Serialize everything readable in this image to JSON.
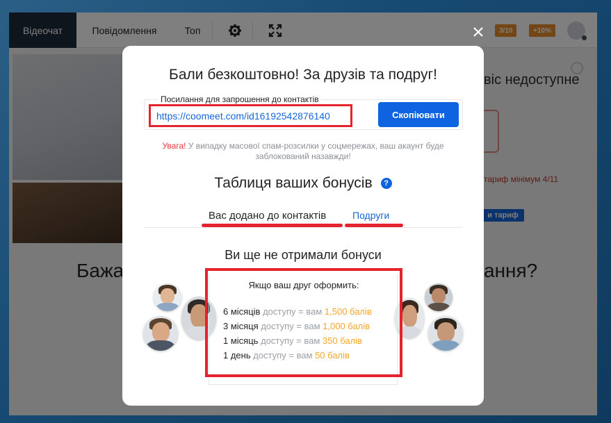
{
  "topbar": {
    "tabs": [
      "Відеочат",
      "Повідомлення",
      "Топ"
    ],
    "minutes_badge": "3/10",
    "bonus_badge": "+10%",
    "icons": [
      "gear-icon",
      "fullscreen-icon",
      "user-icon"
    ]
  },
  "background": {
    "status_text": "віс недоступне",
    "tariff_text": "тариф мінімум 4/11",
    "button_text": "и тариф",
    "heading_left": "Бажа",
    "heading_right": "ання?"
  },
  "modal": {
    "title": "Бали безкоштовно! За друзів та подруг!",
    "link_label": "Посилання для запрошення до контактів",
    "invite_url": "https://coomeet.com/id16192542876140",
    "copy_button": "Скопіювати",
    "warning_word": "Увага!",
    "warning_text": " У випадку масової спам-розсилки у соцмережах, ваш акаунт буде заблокований назавжди!",
    "bonus_table_title": "Таблиця ваших бонусів",
    "help_icon": "?",
    "tabs": {
      "added": "Вас додано до контактів",
      "friends": "Подруги"
    },
    "no_bonus_text": "Ви ще не отримали бонуси",
    "terms_header": "Якщо ваш друг оформить:",
    "terms": [
      {
        "period": "6 місяців",
        "access": "доступу = вам",
        "points": "1,500 балів"
      },
      {
        "period": "3 місяця",
        "access": "доступу = вам",
        "points": "1,000 балів"
      },
      {
        "period": "1 місяць",
        "access": "доступу = вам",
        "points": "350 балів"
      },
      {
        "period": "1 день",
        "access": "доступу = вам",
        "points": "50 балів"
      }
    ]
  },
  "colors": {
    "accent_blue": "#0e63e0",
    "highlight_red": "#e4232f",
    "points_gold": "#f4a62a",
    "dark_tab": "#1f2b3a"
  }
}
